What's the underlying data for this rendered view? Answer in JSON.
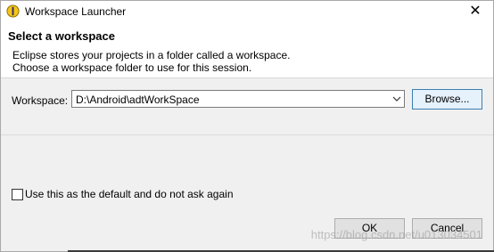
{
  "window": {
    "title": "Workspace Launcher",
    "close_glyph": "✕"
  },
  "header": {
    "title": "Select a workspace",
    "description_lines": [
      "Eclipse stores your projects in a folder called a workspace.",
      "Choose a workspace folder to use for this session."
    ]
  },
  "workspace": {
    "label": "Workspace:",
    "value": "D:\\Android\\adtWorkSpace",
    "browse_label": "Browse..."
  },
  "default_option": {
    "label": "Use this as the default and do not ask again",
    "checked": false
  },
  "buttons": {
    "ok": "OK",
    "cancel": "Cancel"
  },
  "watermark": "https://blog.csdn.net/u013034501",
  "icons": {
    "app": "eclipse-icon",
    "close": "close-icon",
    "dropdown": "chevron-down-icon"
  },
  "colors": {
    "accent": "#3c7fb1",
    "dialog_bg": "#f0f0f0",
    "header_bg": "#ffffff"
  }
}
